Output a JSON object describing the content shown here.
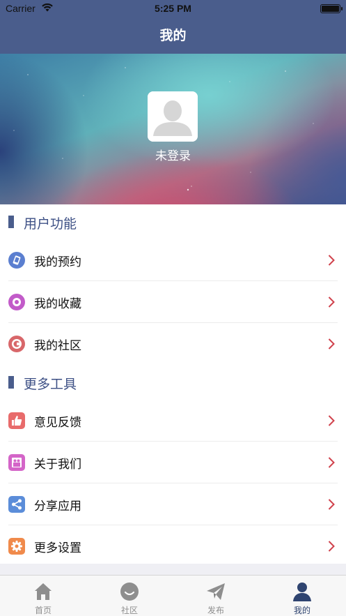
{
  "status_bar": {
    "carrier": "Carrier",
    "time": "5:25 PM"
  },
  "nav": {
    "title": "我的"
  },
  "profile": {
    "login_status": "未登录"
  },
  "sections": [
    {
      "title": "用户功能",
      "items": [
        {
          "label": "我的预约",
          "icon": "appointment-icon",
          "color": "#5b7fd0"
        },
        {
          "label": "我的收藏",
          "icon": "favorites-icon",
          "color": "#c25bc9"
        },
        {
          "label": "我的社区",
          "icon": "community-icon",
          "color": "#d8676a"
        }
      ]
    },
    {
      "title": "更多工具",
      "items": [
        {
          "label": "意见反馈",
          "icon": "thumbs-up-icon",
          "color": "#e86b6b"
        },
        {
          "label": "关于我们",
          "icon": "about-icon",
          "color": "#d465c8"
        },
        {
          "label": "分享应用",
          "icon": "share-icon",
          "color": "#5b8dd9"
        },
        {
          "label": "更多设置",
          "icon": "gear-icon",
          "color": "#f08a4b"
        }
      ]
    }
  ],
  "tabbar": {
    "items": [
      {
        "label": "首页",
        "icon": "home-icon"
      },
      {
        "label": "社区",
        "icon": "smile-icon"
      },
      {
        "label": "发布",
        "icon": "paper-plane-icon"
      },
      {
        "label": "我的",
        "icon": "person-icon",
        "active": true
      }
    ]
  },
  "colors": {
    "accent": "#4a5d8c",
    "chevron": "#d0424c"
  }
}
